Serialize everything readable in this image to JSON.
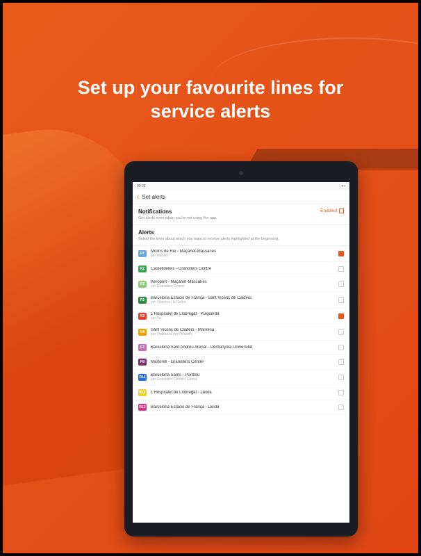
{
  "headline": "Set up your favourite lines for service alerts",
  "statusbar": {
    "time": "09:35",
    "right": "▾ ▪"
  },
  "appbar": {
    "title": "Set alerts"
  },
  "notifications": {
    "title": "Notifications",
    "subtitle": "Get alerts even when you're not using the app.",
    "enabled_label": "Enabled"
  },
  "alerts": {
    "title": "Alerts",
    "subtitle": "Select the lines about which you want to receive alerts highlighted at the beginning."
  },
  "lines": [
    {
      "code": "R1",
      "color": "#6aa6e0",
      "title": "Molins de Rei - Maçanet-Massanes",
      "sub": "per Mataró",
      "checked": true
    },
    {
      "code": "R2",
      "color": "#3aa655",
      "title": "Castelldefels - Granollers Centre",
      "sub": "",
      "checked": false
    },
    {
      "code": "R2",
      "color": "#8fc97a",
      "title": "Aeroport - Maçanet-Massanes",
      "sub": "per Granollers Centre",
      "checked": false
    },
    {
      "code": "R2",
      "color": "#2c8a3e",
      "title": "Barcelona Estació de França - Sant Vicenç de Calders",
      "sub": "per Vilanova i la Geltrú",
      "checked": false
    },
    {
      "code": "R3",
      "color": "#e23b2e",
      "title": "L'Hospitalet de Llobregat - Puigcerdà",
      "sub": "per Vic",
      "checked": true
    },
    {
      "code": "R4",
      "color": "#f2a000",
      "title": "Sant Vicenç de Calders - Manresa",
      "sub": "per Vilafranca del Penedès",
      "checked": false
    },
    {
      "code": "R7",
      "color": "#c66dbb",
      "title": "Barcelona Sant Andreu Arenal - Cerdanyola Universitat",
      "sub": "",
      "checked": false
    },
    {
      "code": "R8",
      "color": "#7a2e6e",
      "title": "Martorell - Granollers Centre",
      "sub": "",
      "checked": false
    },
    {
      "code": "R11",
      "color": "#2a6fd6",
      "title": "Barcelona Sants - Portbou",
      "sub": "per Granollers Centre i Girona",
      "checked": false
    },
    {
      "code": "R12",
      "color": "#e8d22e",
      "title": "L'Hospitalet de Llobregat - Lleida",
      "sub": "",
      "checked": false
    },
    {
      "code": "R13",
      "color": "#d63384",
      "title": "Barcelona Estació de França - Lleida",
      "sub": "",
      "checked": false
    }
  ]
}
